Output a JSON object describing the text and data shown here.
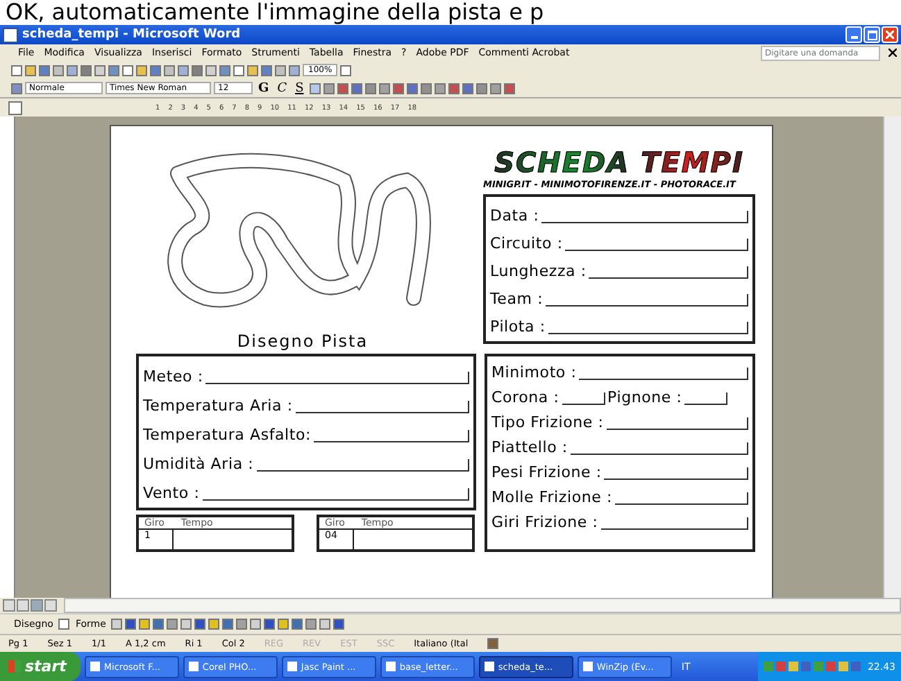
{
  "caption": "OK, automaticamente l'immagine della pista e p",
  "window": {
    "title": "scheda_tempi - Microsoft Word"
  },
  "menu": [
    "File",
    "Modifica",
    "Visualizza",
    "Inserisci",
    "Formato",
    "Strumenti",
    "Tabella",
    "Finestra",
    "?",
    "Adobe PDF",
    "Commenti Acrobat"
  ],
  "help_search": {
    "placeholder": "Digitare una domanda"
  },
  "toolbar": {
    "zoom": "100%",
    "style": "Normale",
    "font": "Times New Roman",
    "size": "12",
    "bold": "G",
    "italic": "C",
    "underline": "S"
  },
  "ruler": [
    "1",
    "2",
    "3",
    "4",
    "5",
    "6",
    "7",
    "8",
    "9",
    "10",
    "11",
    "12",
    "13",
    "14",
    "15",
    "16",
    "17",
    "18"
  ],
  "document": {
    "track_caption": "Disegno Pista",
    "title": "SCHEDA TEMPI",
    "subtitle": "MINIGP.IT - MINIMOTOFIRENZE.IT - PHOTORACE.IT",
    "header_fields": [
      {
        "kind": "single",
        "labels": [
          "Data :"
        ]
      },
      {
        "kind": "single",
        "labels": [
          "Circuito :"
        ]
      },
      {
        "kind": "single",
        "labels": [
          "Lunghezza :"
        ]
      },
      {
        "kind": "single",
        "labels": [
          "Team :"
        ]
      },
      {
        "kind": "single",
        "labels": [
          "Pilota :"
        ]
      }
    ],
    "weather_fields": [
      {
        "kind": "single",
        "labels": [
          "Meteo :"
        ]
      },
      {
        "kind": "single",
        "labels": [
          "Temperatura Aria :"
        ]
      },
      {
        "kind": "single",
        "labels": [
          "Temperatura Asfalto:"
        ]
      },
      {
        "kind": "single",
        "labels": [
          "Umidità Aria :"
        ]
      },
      {
        "kind": "single",
        "labels": [
          "Vento :"
        ]
      }
    ],
    "bike_fields": [
      {
        "kind": "single",
        "labels": [
          "Minimoto :"
        ]
      },
      {
        "kind": "pair",
        "labels": [
          "Corona :",
          "Pignone :"
        ]
      },
      {
        "kind": "single",
        "labels": [
          "Tipo Frizione :"
        ]
      },
      {
        "kind": "single",
        "labels": [
          "Piattello :"
        ]
      },
      {
        "kind": "single",
        "labels": [
          "Pesi Frizione :"
        ]
      },
      {
        "kind": "single",
        "labels": [
          "Molle Frizione :"
        ]
      },
      {
        "kind": "single",
        "labels": [
          "Giri Frizione :"
        ]
      }
    ],
    "lap_tables": [
      {
        "column_1": "Giro",
        "column_2": "Tempo",
        "row": "1"
      },
      {
        "column_1": "Giro",
        "column_2": "Tempo",
        "row": "04"
      }
    ]
  },
  "drawing_toolbar": {
    "draw": "Disegno",
    "shapes": "Forme"
  },
  "status_bar": [
    {
      "text": "Pg 1",
      "disabled": false
    },
    {
      "text": "Sez 1",
      "disabled": false
    },
    {
      "text": "1/1",
      "disabled": false
    },
    {
      "text": "A 1,2 cm",
      "disabled": false
    },
    {
      "text": "Ri 1",
      "disabled": false
    },
    {
      "text": "Col 2",
      "disabled": false
    },
    {
      "text": "REG",
      "disabled": true
    },
    {
      "text": "REV",
      "disabled": true
    },
    {
      "text": "EST",
      "disabled": true
    },
    {
      "text": "SSC",
      "disabled": true
    },
    {
      "text": "Italiano (Ital",
      "disabled": false
    }
  ],
  "taskbar": {
    "start": "start",
    "items": [
      {
        "label": "Microsoft F...",
        "selected": false
      },
      {
        "label": "Corel PHO...",
        "selected": false
      },
      {
        "label": "Jasc Paint ...",
        "selected": false
      },
      {
        "label": "base_letter...",
        "selected": false
      },
      {
        "label": "scheda_te...",
        "selected": true
      },
      {
        "label": "WinZip (Ev...",
        "selected": false
      }
    ],
    "language": "IT",
    "clock": "22.43"
  }
}
